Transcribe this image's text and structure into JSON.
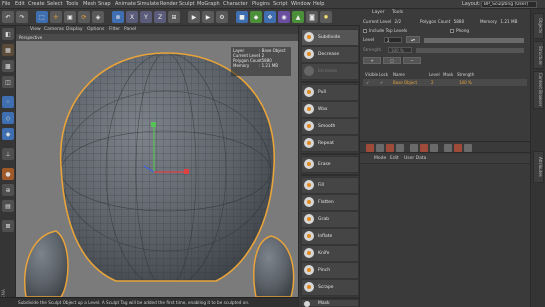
{
  "menubar": {
    "items": [
      "File",
      "Edit",
      "Create",
      "Select",
      "Tools",
      "Mesh",
      "Snap",
      "Animate",
      "Simulate",
      "Render",
      "Sculpt",
      "MoGraph",
      "Character",
      "Plugins",
      "Script",
      "Window",
      "Help"
    ],
    "layout_label": "Layout:",
    "layout_value": "BP_Sculpting (User)"
  },
  "toolbar": {
    "icons": [
      "undo-icon",
      "redo-icon",
      "live-selection-icon",
      "move-icon",
      "scale-icon",
      "rotate-icon",
      "object-axis-icon",
      "x-axis-icon",
      "y-axis-icon",
      "z-axis-icon",
      "coordinate-system-icon",
      "render-view-icon",
      "render-picture-viewer-icon",
      "edit-render-settings-icon",
      "cube-icon",
      "subdivision-icon",
      "cloner-icon",
      "deformer-icon",
      "environment-icon",
      "camera-icon",
      "light-icon"
    ],
    "axis_labels": [
      "X",
      "Y",
      "Z"
    ]
  },
  "viewport": {
    "menu": [
      "View",
      "Cameras",
      "Display",
      "Options",
      "Filter",
      "Panel"
    ],
    "title": "Perspective",
    "hud": {
      "rows": [
        {
          "k": "Layer",
          "v": ": Base Object"
        },
        {
          "k": "Current Level",
          "v": ": 2"
        },
        {
          "k": "Polygon Count",
          "v": ": 5880"
        },
        {
          "k": "Memory",
          "v": ": 1.21 MB"
        }
      ]
    },
    "colors": {
      "background": "#7b7b7b",
      "mesh": "#5f646b",
      "selection": "#e8a33a"
    }
  },
  "statusbar": {
    "text": "Subdivide the Sculpt Object up a Level. A Sculpt Tag will be added the first time, enabling it to be sculpted on."
  },
  "brand": {
    "watermark": "MAXON CINEMA 4D"
  },
  "brushes": {
    "top": [
      {
        "label": "Subdivide",
        "state": "active"
      },
      {
        "label": "Decrease",
        "state": "normal"
      },
      {
        "label": "Increase",
        "state": "disabled"
      }
    ],
    "group1": [
      "Pull",
      "Wax",
      "Smooth",
      "Repeat"
    ],
    "group2": [
      "Erase"
    ],
    "group3": [
      "Fill",
      "Flatten",
      "Grab",
      "Inflate",
      "Knife",
      "Pinch",
      "Scrape"
    ],
    "group4": [
      "Mask"
    ]
  },
  "attributes": {
    "tabs": [
      "Layer",
      "Tools"
    ],
    "current_level_label": "Current Level",
    "current_level_value": "2/2",
    "polygon_count_label": "Polygon Count",
    "polygon_count_value": "5880",
    "memory_label": "Memory",
    "memory_value": "1.21 MB",
    "include_top_levels": "Include Top Levels",
    "phong": "Phong",
    "level_label": "Level",
    "level_value": "2",
    "strength_label": "Strength",
    "strength_value": "100 %",
    "layers_headers": [
      "Visible",
      "Lock",
      "Name",
      "Level",
      "Mask",
      "Strength"
    ],
    "layer_row": {
      "name": "Base Object",
      "level": "2",
      "strength": "100 %"
    }
  },
  "lower_panel": {
    "menu": [
      "Mode",
      "Edit",
      "User Data"
    ]
  },
  "right_tabs": [
    "Objects",
    "Structure",
    "Content Browser",
    "Attributes"
  ]
}
